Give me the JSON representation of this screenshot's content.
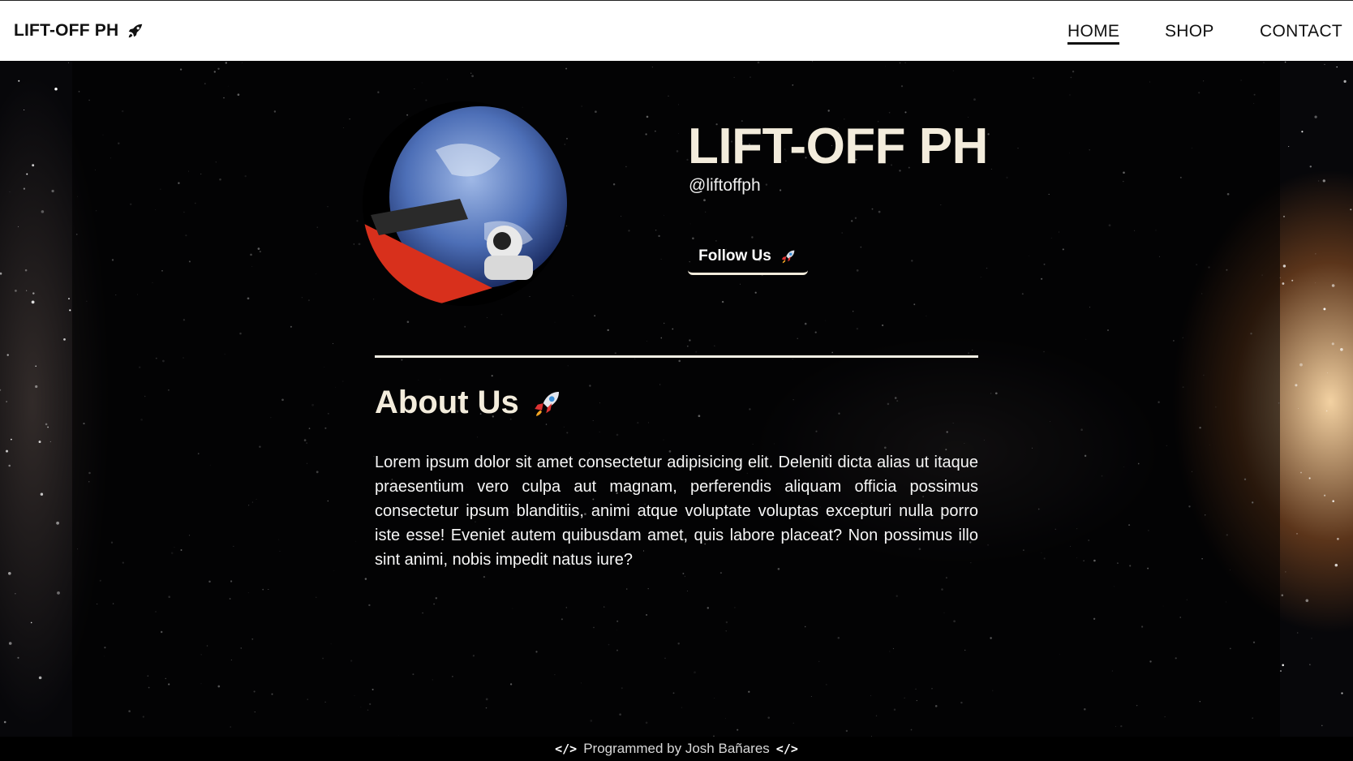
{
  "nav": {
    "brand": "LIFT-OFF PH",
    "brand_icon": "rocket-icon",
    "links": [
      {
        "label": "HOME",
        "active": true
      },
      {
        "label": "SHOP",
        "active": false
      },
      {
        "label": "CONTACT",
        "active": false
      }
    ]
  },
  "profile": {
    "title": "LIFT-OFF PH",
    "handle": "@liftoffph",
    "follow_label": "Follow Us",
    "avatar_icon": "earth-roadster-image"
  },
  "about": {
    "heading": "About Us",
    "heading_icon": "rocket-emoji-icon",
    "text": "Lorem ipsum dolor sit amet consectetur adipisicing elit. Deleniti dicta alias ut itaque praesentium vero culpa aut magnam, perferendis aliquam officia possimus consectetur ipsum blanditiis, animi atque voluptate voluptas excepturi nulla porro iste esse! Eveniet autem quibusdam amet, quis labore placeat? Non possimus illo sint animi, nobis impedit natus iure?"
  },
  "footer": {
    "text": "Programmed by Josh Bañares",
    "icon": "code-icon"
  },
  "colors": {
    "accent": "#f3ecdc",
    "background": "#07070a"
  }
}
